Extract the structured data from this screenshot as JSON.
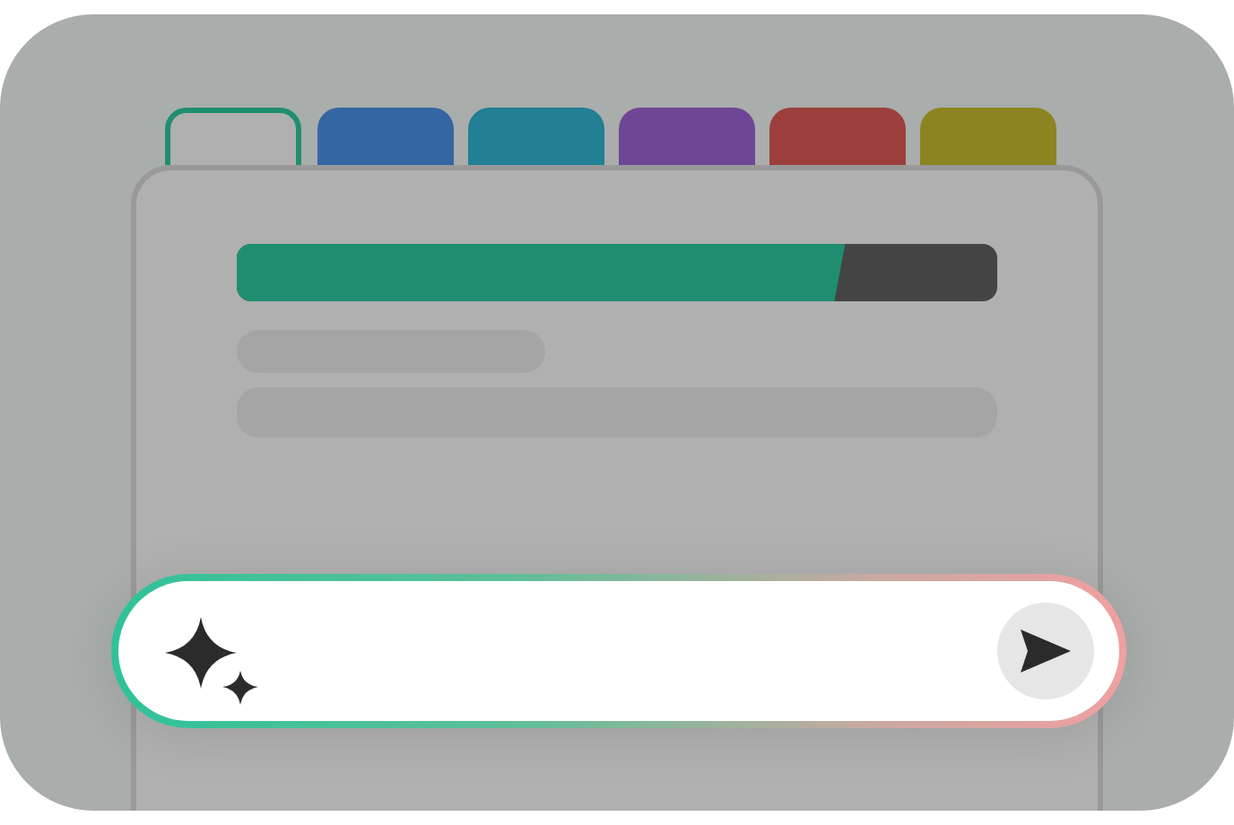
{
  "tabs": [
    {
      "selected": true,
      "color": "#1f8e70"
    },
    {
      "selected": false,
      "color": "#3366a3"
    },
    {
      "selected": false,
      "color": "#227f95"
    },
    {
      "selected": false,
      "color": "#6f4596"
    },
    {
      "selected": false,
      "color": "#9c3f3c"
    },
    {
      "selected": false,
      "color": "#8b8420"
    }
  ],
  "progress": {
    "level": 0.8
  }
}
